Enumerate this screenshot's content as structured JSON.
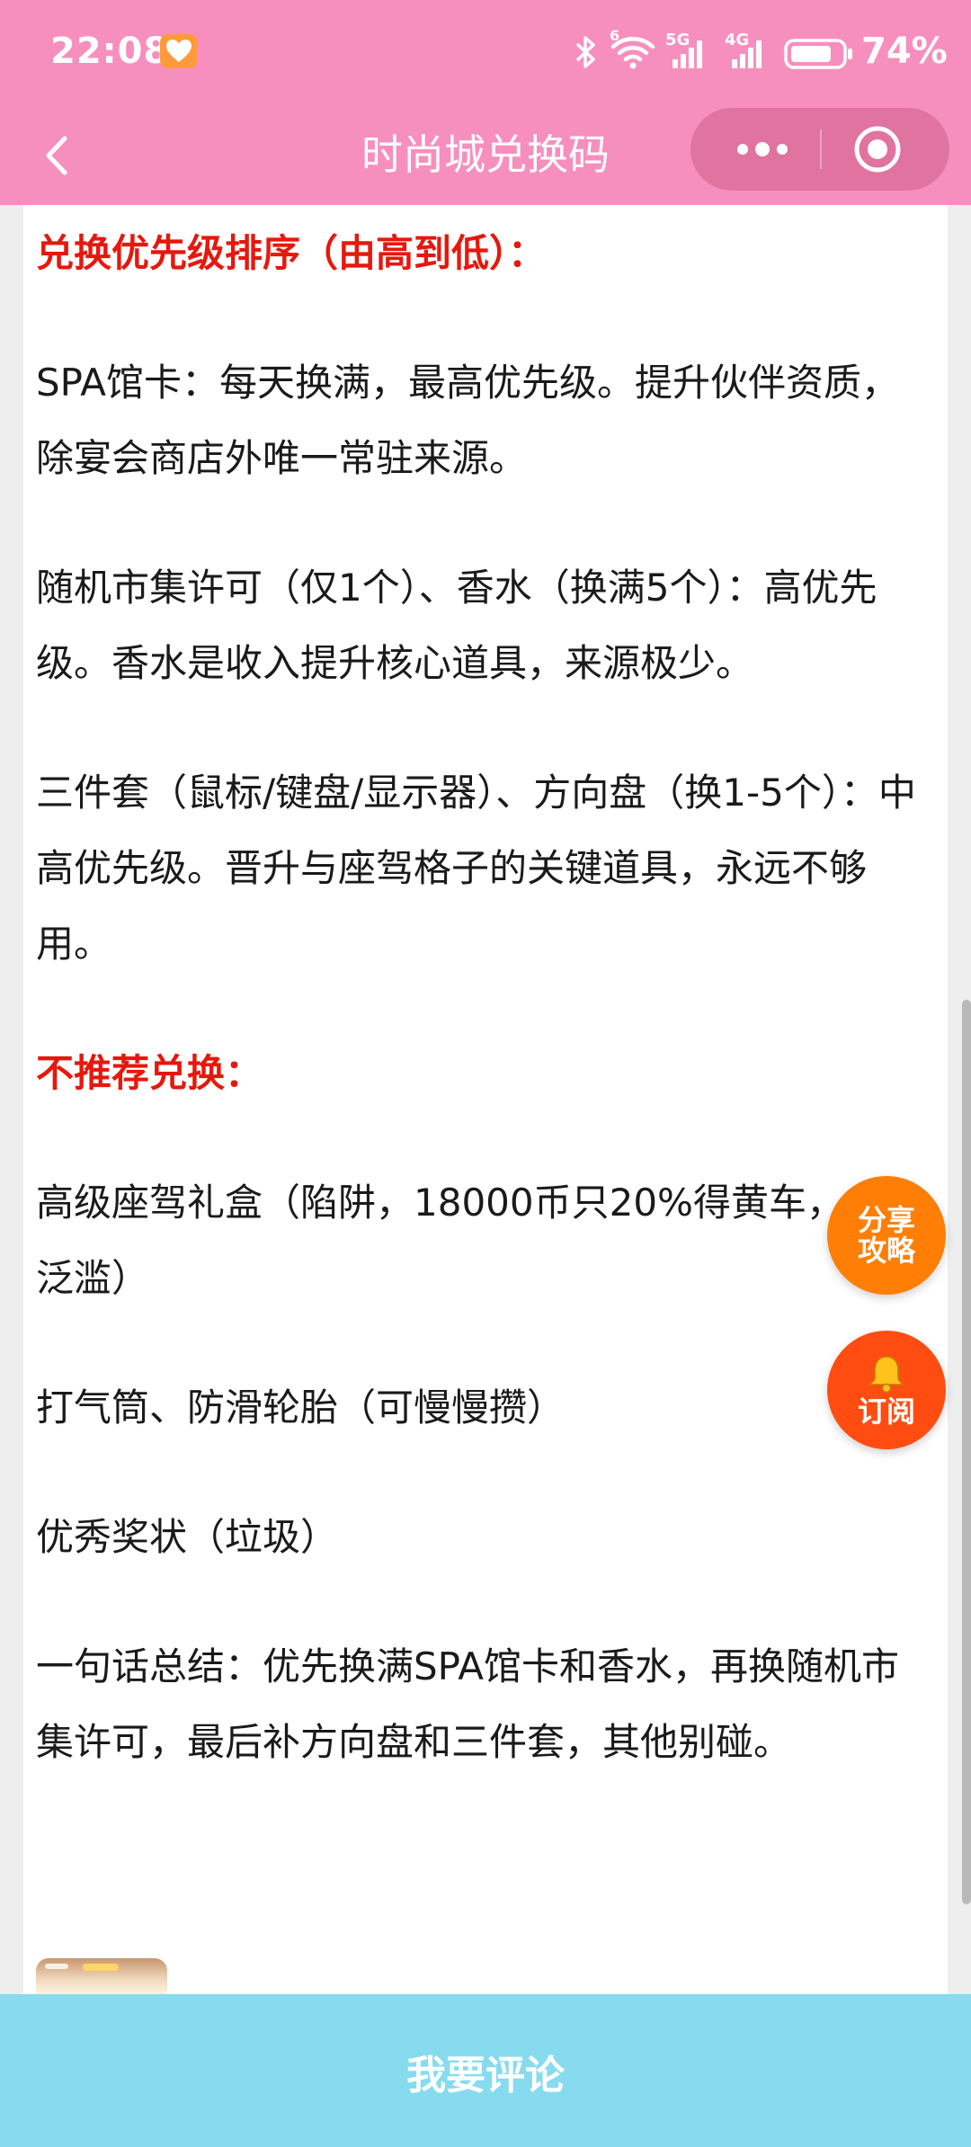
{
  "status_bar": {
    "time": "22:08",
    "battery_percent": "74%",
    "network_1": "5G",
    "network_2": "4G",
    "wifi_badge": "6"
  },
  "nav": {
    "title": "时尚城兑换码"
  },
  "article": {
    "heading_priority": "兑换优先级排序（由高到低）：",
    "para_spa": "SPA馆卡：每天换满，最高优先级。提升伙伴资质，除宴会商店外唯一常驻来源。",
    "para_market": "随机市集许可（仅1个）、香水（换满5个）：高优先级。香水是收入提升核心道具，来源极少。",
    "para_set": "三件套（鼠标/键盘/显示器）、方向盘（换1-5个）：中高优先级。晋升与座驾格子的关键道具，永远不够用。",
    "heading_not_recommended": "不推荐兑换：",
    "para_giftbox": "高级座驾礼盒（陷阱，18000币只20%得黄车，中期泛滥）",
    "para_pump": "打气筒、防滑轮胎（可慢慢攒）",
    "para_award": "优秀奖状（垃圾）",
    "para_summary": "一句话总结：优先换满SPA馆卡和香水，再换随机市集许可，最后补方向盘和三件套，其他别碰。"
  },
  "float_buttons": {
    "share_line1": "分享",
    "share_line2": "攻略",
    "subscribe_label": "订阅"
  },
  "bottom_bar": {
    "comment_label": "我要评论"
  },
  "colors": {
    "header_bg": "#f78fbe",
    "heading_red": "#e6180d",
    "share_orange": "#fe7e06",
    "subscribe_red": "#ff4d12",
    "comment_bar_bg": "#87dbef"
  }
}
